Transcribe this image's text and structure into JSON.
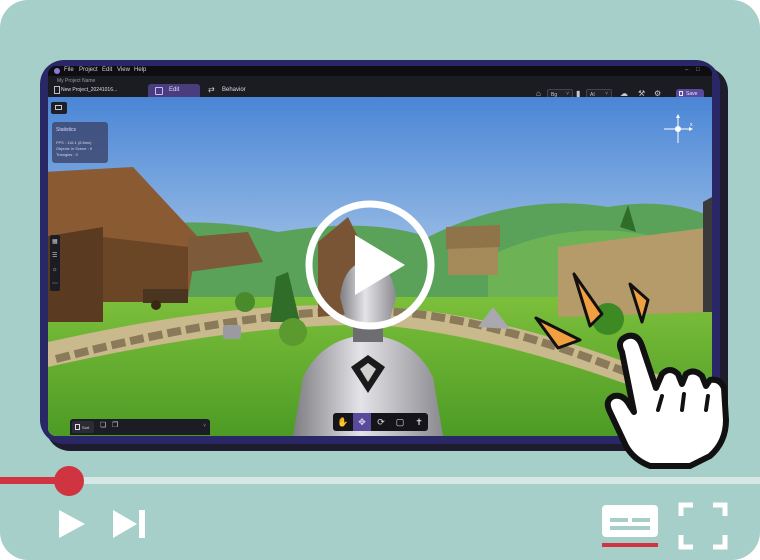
{
  "menubar": {
    "items": [
      "File",
      "Project",
      "Edit",
      "View",
      "Help"
    ],
    "window_controls": [
      "–",
      "□"
    ]
  },
  "project": {
    "name_label": "My Project Name",
    "path": "New Project_20241016..."
  },
  "tabs": [
    {
      "label": "Edit",
      "active": true
    },
    {
      "label": "Behavior",
      "active": false
    }
  ],
  "toolbar_right": {
    "dropdown1_value": "Bg",
    "dropdown2_value": "AI",
    "save_label": "Save"
  },
  "stats": {
    "title": "Statistics",
    "lines": [
      "FPS : 116.1 (8.6ms)",
      "Objects In Scene : 9",
      "Triangles : 0"
    ]
  },
  "gizmo": {
    "axis_label": "x"
  },
  "bottom_panel": {
    "tab_label": "Sort",
    "chevron": "˅"
  },
  "colors": {
    "card_bg": "#a6cfc9",
    "tablet_frame": "#2a2767",
    "accent_purple": "#5a4a9c",
    "progress_red": "#cf3440"
  },
  "player": {
    "progress_fraction": 0.09
  },
  "icons": [
    "play-icon",
    "next-icon",
    "captions-icon",
    "fullscreen-icon",
    "pointer-hand-icon",
    "video-play-icon"
  ]
}
